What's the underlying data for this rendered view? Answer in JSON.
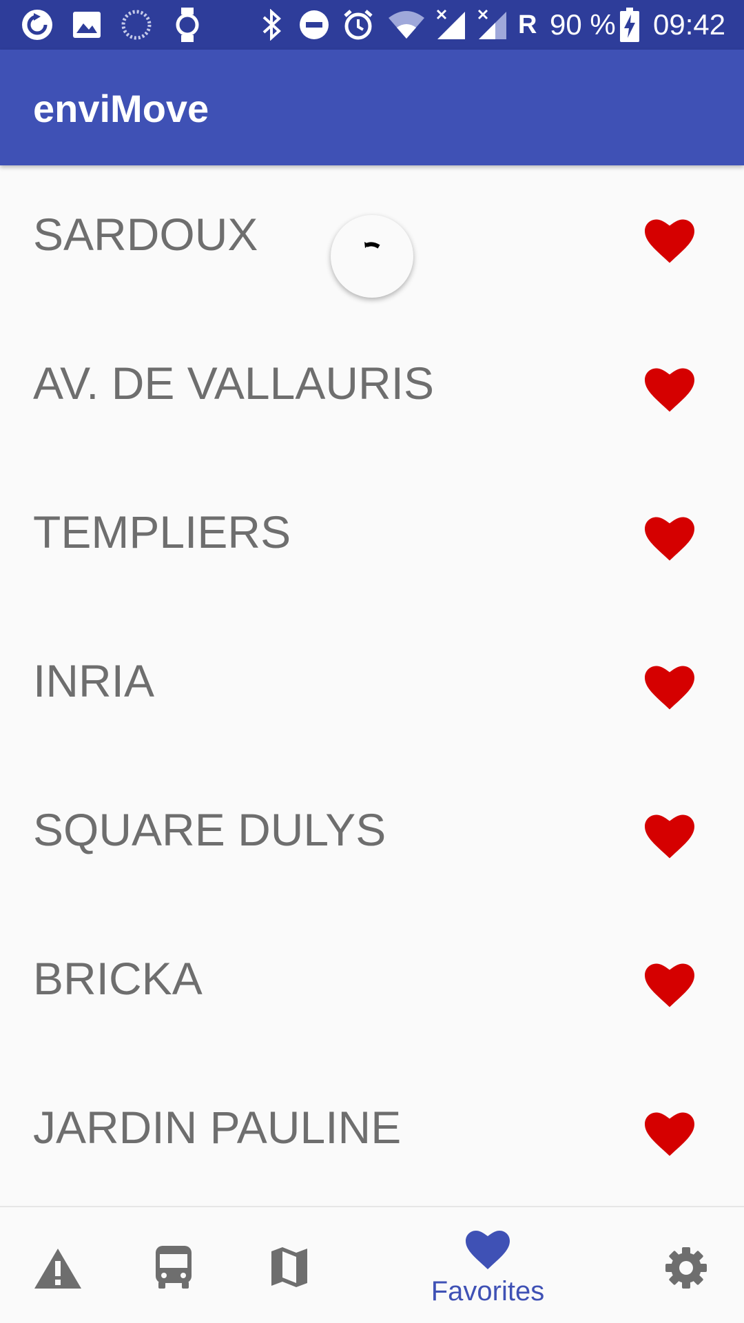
{
  "status_bar": {
    "battery": "90 %",
    "time": "09:42",
    "roaming": "R",
    "icons": [
      "sync-icon",
      "image-icon",
      "loading-icon",
      "watch-icon",
      "bluetooth-icon",
      "do-not-disturb-icon",
      "alarm-icon",
      "wifi-icon",
      "signal-icon",
      "signal-2-icon",
      "battery-charging-icon"
    ]
  },
  "app_bar": {
    "title": "enviMove"
  },
  "favorites": [
    {
      "label": "SARDOUX"
    },
    {
      "label": "AV. DE VALLAURIS"
    },
    {
      "label": "TEMPLIERS"
    },
    {
      "label": "INRIA"
    },
    {
      "label": "SQUARE DULYS"
    },
    {
      "label": "BRICKA"
    },
    {
      "label": "JARDIN PAULINE"
    }
  ],
  "bottom_nav": {
    "items": [
      {
        "icon": "warning-icon"
      },
      {
        "icon": "bus-icon"
      },
      {
        "icon": "map-icon"
      },
      {
        "icon": "heart-icon",
        "label": "Favorites",
        "active": true
      },
      {
        "icon": "gear-icon"
      }
    ]
  },
  "colors": {
    "status_bar": "#2e3d9a",
    "app_bar": "#3f51b5",
    "heart": "#d50000",
    "item_text": "#6e6e6e",
    "nav_inactive": "#6e6e6e",
    "nav_active": "#3f51b5"
  }
}
